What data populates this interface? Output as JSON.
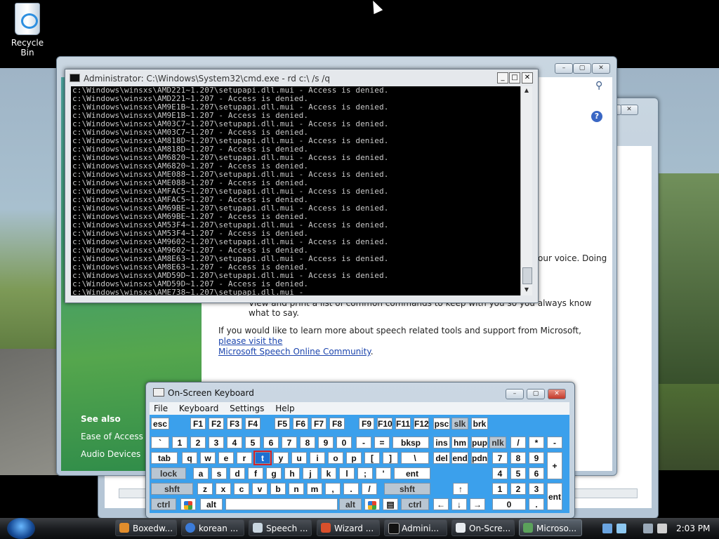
{
  "desktop": {
    "recycle_bin_label": "Recycle Bin"
  },
  "speech_window": {
    "right_text_1": "our voice.  Doing",
    "right_text_2": "View and print a list of common commands to keep with you so you always know what to say.",
    "paragraph_prefix": "If you would like to learn more about speech related tools and support from Microsoft, ",
    "link_text_1": "please visit the",
    "link_text_2": "Microsoft Speech Online Community",
    "paragraph_suffix": ".",
    "see_also": {
      "heading": "See also",
      "items": [
        "Ease of Access",
        "Audio Devices"
      ]
    }
  },
  "back_window": {
    "glyph": ")"
  },
  "cmd": {
    "title": "Administrator: C:\\Windows\\System32\\cmd.exe - rd  c:\\ /s /q",
    "output": "c:\\Windows\\winsxs\\AMD221~1.207\\setupapi.dll.mui - Access is denied.\nc:\\Windows\\winsxs\\AMD221~1.207 - Access is denied.\nc:\\Windows\\winsxs\\AM9E1B~1.207\\setupapi.dll.mui - Access is denied.\nc:\\Windows\\winsxs\\AM9E1B~1.207 - Access is denied.\nc:\\Windows\\winsxs\\AM03C7~1.207\\setupapi.dll.mui - Access is denied.\nc:\\Windows\\winsxs\\AM03C7~1.207 - Access is denied.\nc:\\Windows\\winsxs\\AM818D~1.207\\setupapi.dll.mui - Access is denied.\nc:\\Windows\\winsxs\\AM818D~1.207 - Access is denied.\nc:\\Windows\\winsxs\\AM6820~1.207\\setupapi.dll.mui - Access is denied.\nc:\\Windows\\winsxs\\AM6820~1.207 - Access is denied.\nc:\\Windows\\winsxs\\AME088~1.207\\setupapi.dll.mui - Access is denied.\nc:\\Windows\\winsxs\\AME088~1.207 - Access is denied.\nc:\\Windows\\winsxs\\AMFAC5~1.207\\setupapi.dll.mui - Access is denied.\nc:\\Windows\\winsxs\\AMFAC5~1.207 - Access is denied.\nc:\\Windows\\winsxs\\AM69BE~1.207\\setupapi.dll.mui - Access is denied.\nc:\\Windows\\winsxs\\AM69BE~1.207 - Access is denied.\nc:\\Windows\\winsxs\\AM53F4~1.207\\setupapi.dll.mui - Access is denied.\nc:\\Windows\\winsxs\\AM53F4~1.207 - Access is denied.\nc:\\Windows\\winsxs\\AM9602~1.207\\setupapi.dll.mui - Access is denied.\nc:\\Windows\\winsxs\\AM9602~1.207 - Access is denied.\nc:\\Windows\\winsxs\\AM8E63~1.207\\setupapi.dll.mui - Access is denied.\nc:\\Windows\\winsxs\\AM8E63~1.207 - Access is denied.\nc:\\Windows\\winsxs\\AMD59D~1.207\\setupapi.dll.mui - Access is denied.\nc:\\Windows\\winsxs\\AMD59D~1.207 - Access is denied.\nc:\\Windows\\winsxs\\AME738~1.207\\setupapi.dll.mui -"
  },
  "osk": {
    "title": "On-Screen Keyboard",
    "menu": [
      "File",
      "Keyboard",
      "Settings",
      "Help"
    ],
    "active_key": "t",
    "rows": {
      "r1": [
        "esc",
        "F1",
        "F2",
        "F3",
        "F4",
        "F5",
        "F6",
        "F7",
        "F8",
        "F9",
        "F10",
        "F11",
        "F12",
        "psc",
        "slk",
        "brk"
      ],
      "r2": [
        "`",
        "1",
        "2",
        "3",
        "4",
        "5",
        "6",
        "7",
        "8",
        "9",
        "0",
        "-",
        "=",
        "bksp",
        "ins",
        "hm",
        "pup",
        "nlk",
        "/",
        "*",
        "-"
      ],
      "r3": [
        "tab",
        "q",
        "w",
        "e",
        "r",
        "t",
        "y",
        "u",
        "i",
        "o",
        "p",
        "[",
        "]",
        "\\",
        "del",
        "end",
        "pdn",
        "7",
        "8",
        "9",
        "+"
      ],
      "r4": [
        "lock",
        "a",
        "s",
        "d",
        "f",
        "g",
        "h",
        "j",
        "k",
        "l",
        ";",
        "'",
        "ent",
        "4",
        "5",
        "6"
      ],
      "r5": [
        "shft",
        "z",
        "x",
        "c",
        "v",
        "b",
        "n",
        "m",
        ",",
        ".",
        "/",
        "shft",
        "↑",
        "1",
        "2",
        "3",
        "ent"
      ],
      "r6": [
        "ctrl",
        "win",
        "alt",
        "",
        "alt",
        "win",
        "menu",
        "ctrl",
        "←",
        "↓",
        "→",
        "0",
        "."
      ]
    }
  },
  "taskbar": {
    "items": [
      "Boxedw...",
      "korean ...",
      "Speech ...",
      "Wizard ...",
      "Admini...",
      "On-Scre...",
      "Microso..."
    ],
    "active_index": 6,
    "clock": "2:03 PM"
  },
  "colors": {
    "osk_key_area": "#3ba0ec",
    "active_key_outline": "#d2232a",
    "link": "#1c45ad"
  }
}
